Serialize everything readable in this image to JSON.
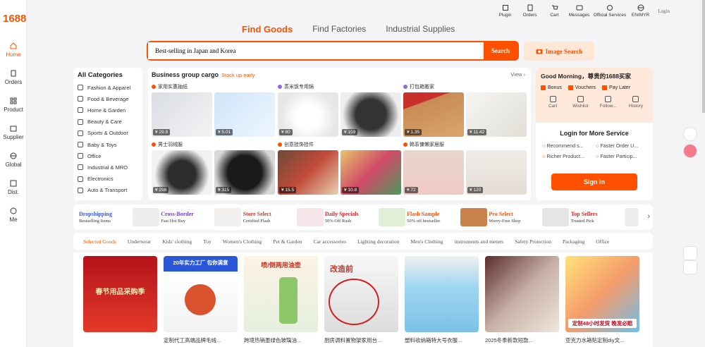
{
  "logo": "1688",
  "sidebar": [
    {
      "label": "Home",
      "icon": "home-icon",
      "active": true
    },
    {
      "label": "Orders",
      "icon": "orders-icon"
    },
    {
      "label": "Product",
      "icon": "grid-icon"
    },
    {
      "label": "Supplier",
      "icon": "supplier-icon"
    },
    {
      "label": "Global",
      "icon": "globe-icon"
    },
    {
      "label": "Dist.",
      "icon": "dist-icon"
    },
    {
      "label": "Me",
      "icon": "user-icon"
    }
  ],
  "topnav": [
    {
      "label": "Plugin",
      "icon": "puzzle-icon"
    },
    {
      "label": "Orders",
      "icon": "clipboard-icon"
    },
    {
      "label": "Cart",
      "icon": "cart-icon"
    },
    {
      "label": "Messages",
      "icon": "chat-icon"
    },
    {
      "label": "Official Services",
      "icon": "headset-icon"
    },
    {
      "label": "EN/MYR",
      "icon": "globe-icon"
    }
  ],
  "login_link": "Login",
  "search_tabs": [
    "Find Goods",
    "Find Factories",
    "Industrial Supplies"
  ],
  "search": {
    "value": "Best-selling in Japan and Korea",
    "button": "Search",
    "image_search": "Image Search"
  },
  "categories": {
    "title": "All Categories",
    "items": [
      "Fashion & Apparel",
      "Food & Beverage",
      "Home & Garden",
      "Beauty & Care",
      "Sports & Outdoor",
      "Baby & Toys",
      "Office",
      "Industrial & MRO",
      "Electronics",
      "Auto & Transport"
    ]
  },
  "business": {
    "title": "Business group cargo",
    "subtitle": "Stock up early",
    "view": "View",
    "groups": [
      {
        "title": "家用实惠抽纸",
        "prices": [
          "¥ 29.8",
          "¥ 5.01"
        ]
      },
      {
        "title": "蒸米饭专用锅",
        "prices": [
          "¥ 80",
          "¥ 159"
        ]
      },
      {
        "title": "打包箱搬家",
        "prices": [
          "¥ 1.35",
          "¥ 11.42"
        ]
      },
      {
        "title": "男士羽绒服",
        "prices": [
          "¥ 298",
          "¥ 315"
        ]
      },
      {
        "title": "创意挂饰挂件",
        "prices": [
          "¥ 15.5",
          "¥ 10.8"
        ]
      },
      {
        "title": "韩系慵懒家居服",
        "prices": [
          "¥ 72",
          "¥ 120"
        ]
      }
    ]
  },
  "user_panel": {
    "greeting": "Good Morning，尊贵的1688买家",
    "perks": [
      "Bonus",
      "Vouchers",
      "Pay Later"
    ],
    "actions": [
      "Cart",
      "Wishlist",
      "Follow...",
      "History"
    ],
    "login_more": "Login for More Service",
    "services": [
      "Recommend s...",
      "Faster Order U...",
      "Richer Product...",
      "Faster Particip..."
    ],
    "signin": "Sign in"
  },
  "promos": [
    {
      "title": "Dropshipping",
      "sub": "Bestselling Items",
      "color": "#3a5bd9"
    },
    {
      "title": "Cross-Border",
      "sub": "Fast Hot Buy",
      "color": "#7a3fc9"
    },
    {
      "title": "Store Select",
      "sub": "Certified Flash",
      "color": "#c23d2e"
    },
    {
      "title": "Daily Specials",
      "sub": "50% Off Rush",
      "color": "#e02020"
    },
    {
      "title": "Flash Sample",
      "sub": "50% off bestseller",
      "color": "#ff5000"
    },
    {
      "title": "Pro Select",
      "sub": "Worry-Free Shop",
      "color": "#ff5000"
    },
    {
      "title": "Top Sellers",
      "sub": "Trusted Pick",
      "color": "#e02020"
    }
  ],
  "feed_tabs": [
    "Selected Goods",
    "Underwear",
    "Kids' clothing",
    "Toy",
    "Women's Clothing",
    "Pet & Garden",
    "Car accessories",
    "Lighting decoration",
    "Men's Clothing",
    "instruments and meters",
    "Safety Protection",
    "Packaging",
    "Office"
  ],
  "feed": [
    {
      "title": "",
      "bg": "#c9161b",
      "text": "春节用品采购季"
    },
    {
      "title": "定制代工高端品牌毛绒...",
      "bg": "#f2f6ff",
      "text": "20年实力工厂 包你满意"
    },
    {
      "title": "跨境热销墨绿色玻璃油...",
      "bg": "#eef5ea",
      "text": "喷/倒两用油壶"
    },
    {
      "title": "厨房调料置物架家用台...",
      "bg": "#f4f4f4",
      "text": "改造前"
    },
    {
      "title": "塑料收纳箱特大号衣服...",
      "bg": "#9fd6f1",
      "text": ""
    },
    {
      "title": "2025冬季新款短款...",
      "bg": "#d6c8c0",
      "text": ""
    },
    {
      "title": "亚克力水箱贴定制diy文...",
      "bg": "#fff1b8",
      "text": "定制48小时发货 晚发必赔"
    }
  ]
}
